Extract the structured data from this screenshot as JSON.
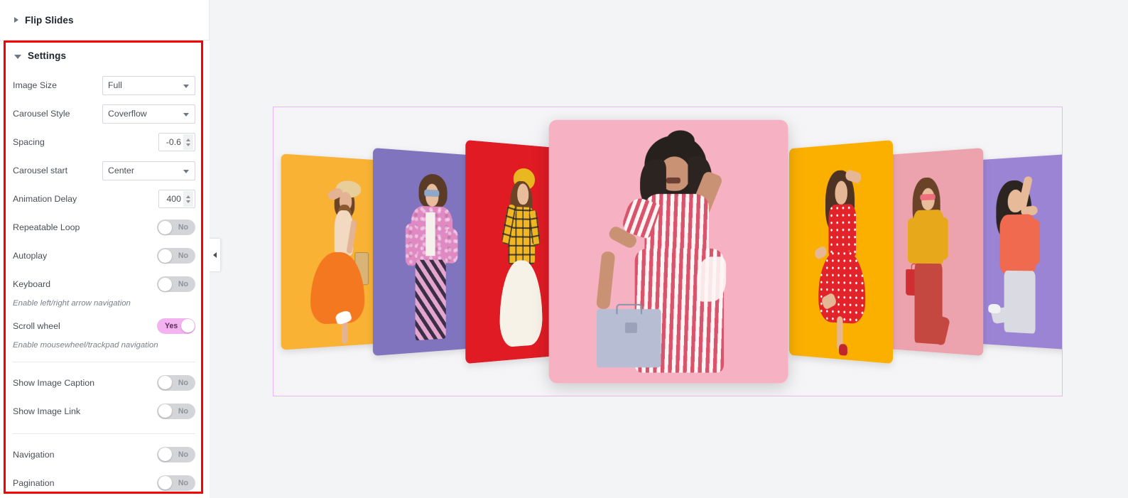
{
  "panel": {
    "flip_slides": {
      "title": "Flip Slides",
      "state": "collapsed",
      "icon": "triangle-right-icon"
    },
    "settings": {
      "title": "Settings",
      "state": "expanded",
      "icon": "triangle-down-icon"
    },
    "collapse_handle_icon": "chevron-left-icon",
    "highlight_color": "#fc0000",
    "controls": [
      {
        "name": "image-size",
        "label": "Image Size",
        "type": "select",
        "value": "Full"
      },
      {
        "name": "carousel-style",
        "label": "Carousel Style",
        "type": "select",
        "value": "Coverflow"
      },
      {
        "name": "spacing",
        "label": "Spacing",
        "type": "number",
        "value": "-0.6"
      },
      {
        "name": "carousel-start",
        "label": "Carousel start",
        "type": "select",
        "value": "Center"
      },
      {
        "name": "animation-delay",
        "label": "Animation Delay",
        "type": "number",
        "value": "400"
      },
      {
        "name": "repeatable-loop",
        "label": "Repeatable Loop",
        "type": "toggle",
        "value": "No",
        "on": false
      },
      {
        "name": "autoplay",
        "label": "Autoplay",
        "type": "toggle",
        "value": "No",
        "on": false
      },
      {
        "name": "keyboard",
        "label": "Keyboard",
        "type": "toggle",
        "value": "No",
        "on": false,
        "desc": "Enable left/right arrow navigation"
      },
      {
        "name": "scroll-wheel",
        "label": "Scroll wheel",
        "type": "toggle",
        "value": "Yes",
        "on": true,
        "desc": "Enable mousewheel/trackpad navigation"
      },
      {
        "name": "show-image-caption",
        "label": "Show Image Caption",
        "type": "toggle",
        "value": "No",
        "on": false,
        "divider_before": true
      },
      {
        "name": "show-image-link",
        "label": "Show Image Link",
        "type": "toggle",
        "value": "No",
        "on": false
      },
      {
        "name": "navigation",
        "label": "Navigation",
        "type": "toggle",
        "value": "No",
        "on": false,
        "icon": "desktop-monitor-icon",
        "divider_before": true
      },
      {
        "name": "pagination",
        "label": "Pagination",
        "type": "toggle",
        "value": "No",
        "on": false,
        "icon": "desktop-monitor-icon"
      }
    ],
    "toggle_on_color": "#f3b3f0",
    "toggle_off_color": "#d3d5d9"
  },
  "canvas": {
    "background": "#f3f4f6",
    "widget_border_color": "#eab6f7",
    "carousel_style": "coverflow",
    "slides": [
      {
        "name": "slide-1",
        "bg": "#f9b233",
        "position": "left-3",
        "alt": "woman in orange skirt with straw hat and basket bag"
      },
      {
        "name": "slide-2",
        "bg": "#8074bf",
        "position": "left-2",
        "alt": "woman in pink fur coat and striped trousers"
      },
      {
        "name": "slide-3",
        "bg": "#e01b24",
        "position": "left-1",
        "alt": "woman in yellow plaid shirt and white skirt with hat"
      },
      {
        "name": "slide-4",
        "bg": "#f6b2c2",
        "position": "center",
        "alt": "woman in red striped dress holding blue suitcase"
      },
      {
        "name": "slide-5",
        "bg": "#fbb000",
        "position": "right-1",
        "alt": "woman in red polka dot dress"
      },
      {
        "name": "slide-6",
        "bg": "#eda3ad",
        "position": "right-2",
        "alt": "woman in yellow blouse and red trousers with red bucket bag"
      },
      {
        "name": "slide-7",
        "bg": "#9b84d4",
        "position": "right-3",
        "alt": "woman in coral sweater and light trousers"
      }
    ]
  }
}
